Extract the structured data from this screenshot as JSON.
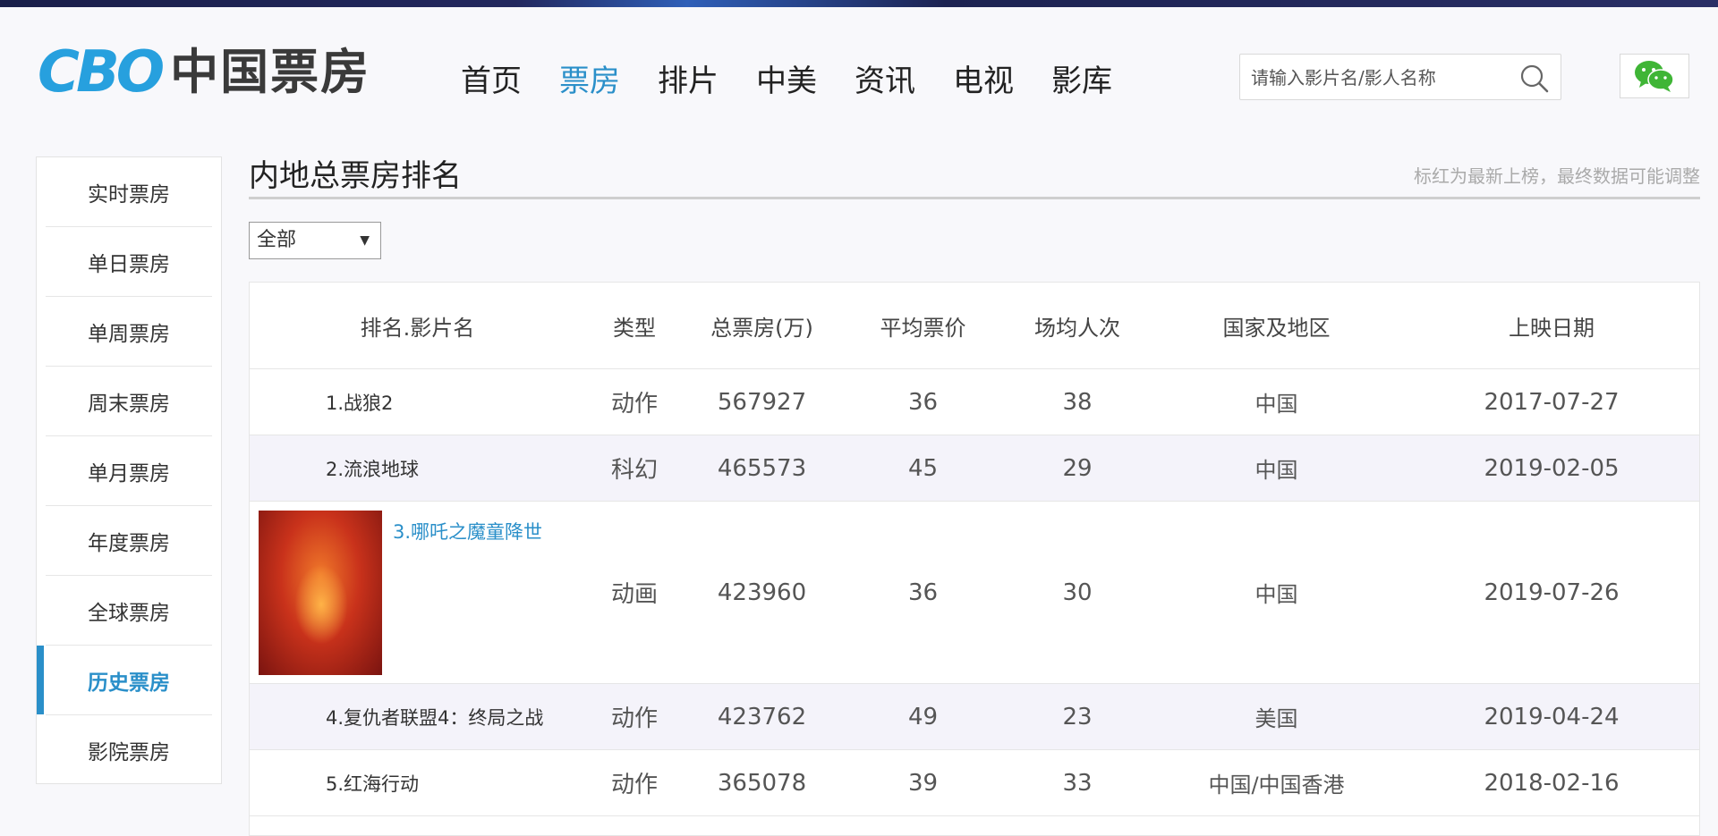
{
  "header": {
    "logo_mark": "CBO",
    "logo_text": "中国票房",
    "nav": [
      {
        "label": "首页",
        "active": false
      },
      {
        "label": "票房",
        "active": true
      },
      {
        "label": "排片",
        "active": false
      },
      {
        "label": "中美",
        "active": false
      },
      {
        "label": "资讯",
        "active": false
      },
      {
        "label": "电视",
        "active": false
      },
      {
        "label": "影库",
        "active": false
      }
    ],
    "search_placeholder": "请输入影片名/影人名称",
    "search_icon": "search-icon",
    "wechat_icon": "wechat-icon",
    "accent_color": "#2a8fc9"
  },
  "sidebar": {
    "items": [
      {
        "label": "实时票房",
        "active": false
      },
      {
        "label": "单日票房",
        "active": false
      },
      {
        "label": "单周票房",
        "active": false
      },
      {
        "label": "周末票房",
        "active": false
      },
      {
        "label": "单月票房",
        "active": false
      },
      {
        "label": "年度票房",
        "active": false
      },
      {
        "label": "全球票房",
        "active": false
      },
      {
        "label": "历史票房",
        "active": true
      },
      {
        "label": "影院票房",
        "active": false
      }
    ]
  },
  "main": {
    "title": "内地总票房排名",
    "note": "标红为最新上榜，最终数据可能调整",
    "filter_value": "全部",
    "table": {
      "headers": [
        "排名.影片名",
        "类型",
        "总票房(万)",
        "平均票价",
        "场均人次",
        "国家及地区",
        "上映日期"
      ],
      "rows": [
        {
          "name": "1.战狼2",
          "type": "动作",
          "total": "567927",
          "price": "36",
          "people": "38",
          "country": "中国",
          "date": "2017-07-27"
        },
        {
          "name": "2.流浪地球",
          "type": "科幻",
          "total": "465573",
          "price": "45",
          "people": "29",
          "country": "中国",
          "date": "2019-02-05"
        },
        {
          "name": "3.哪吒之魔童降世",
          "type": "动画",
          "total": "423960",
          "price": "36",
          "people": "30",
          "country": "中国",
          "date": "2019-07-26"
        },
        {
          "name": "4.复仇者联盟4：终局之战",
          "type": "动作",
          "total": "423762",
          "price": "49",
          "people": "23",
          "country": "美国",
          "date": "2019-04-24"
        },
        {
          "name": "5.红海行动",
          "type": "动作",
          "total": "365078",
          "price": "39",
          "people": "33",
          "country": "中国/中国香港",
          "date": "2018-02-16"
        }
      ]
    }
  }
}
